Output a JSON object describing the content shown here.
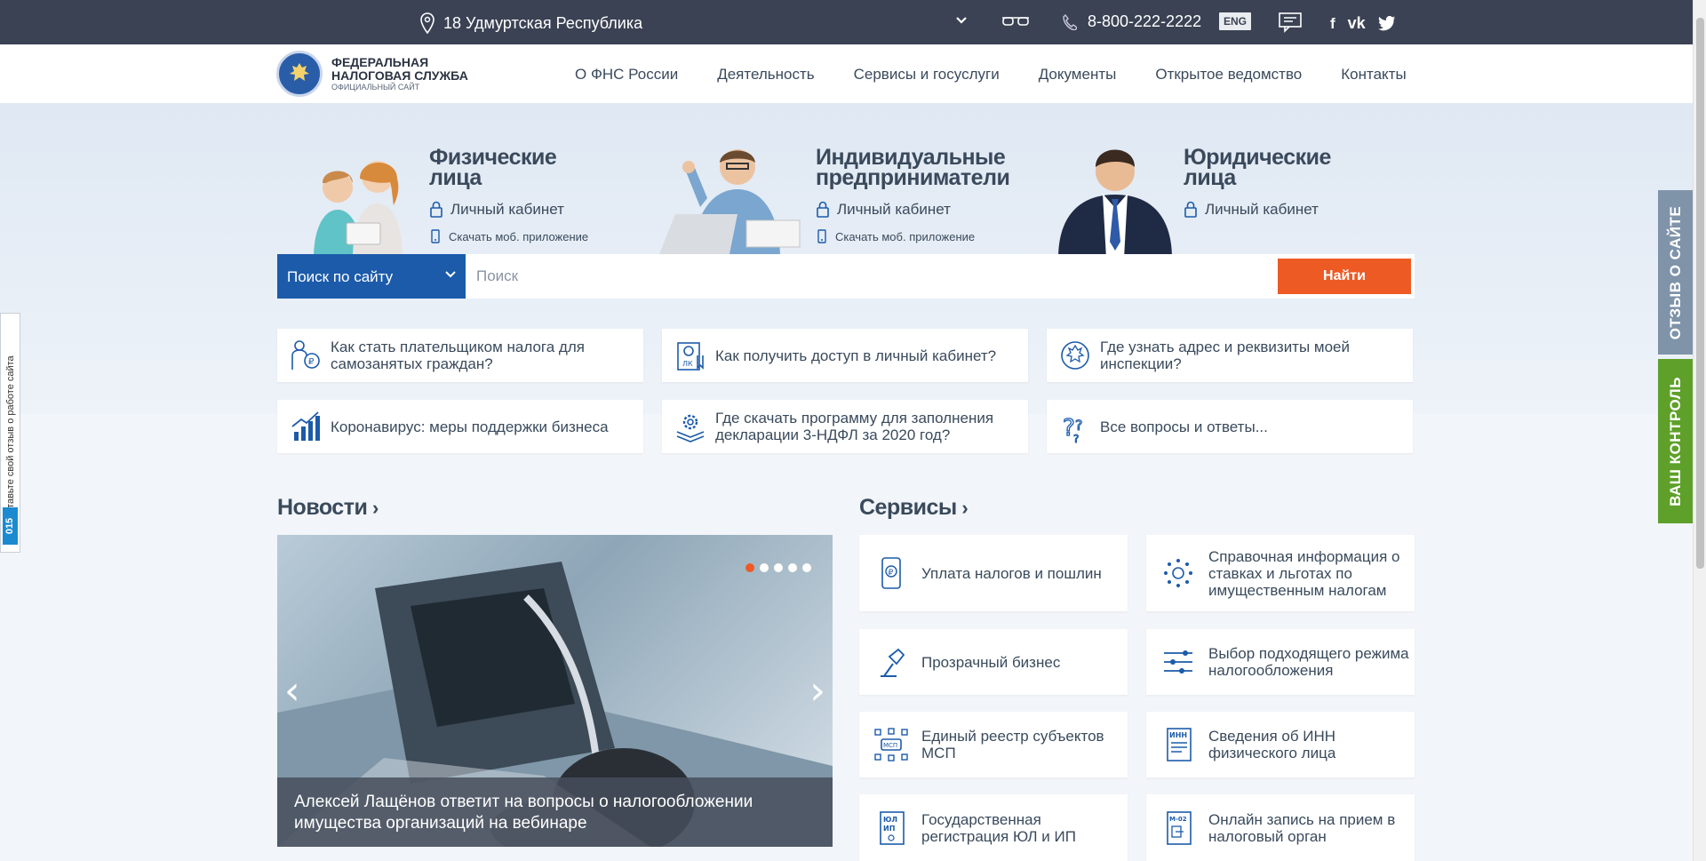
{
  "topbar": {
    "region": "18 Удмуртская Республика",
    "phone": "8-800-222-2222",
    "lang": "ENG",
    "social": [
      "f",
      "vk",
      "twitter"
    ]
  },
  "header": {
    "logo_line1": "ФЕДЕРАЛЬНАЯ",
    "logo_line2": "НАЛОГОВАЯ СЛУЖБА",
    "logo_line3": "ОФИЦИАЛЬНЫЙ САЙТ",
    "nav": [
      "О ФНС России",
      "Деятельность",
      "Сервисы и госуслуги",
      "Документы",
      "Открытое ведомство",
      "Контакты"
    ]
  },
  "hero": {
    "groups": [
      {
        "title1": "Физические",
        "title2": "лица",
        "cabinet": "Личный кабинет",
        "app": "Скачать моб. приложение"
      },
      {
        "title1": "Индивидуальные",
        "title2": "предприниматели",
        "cabinet": "Личный кабинет",
        "app": "Скачать моб. приложение"
      },
      {
        "title1": "Юридические",
        "title2": "лица",
        "cabinet": "Личный кабинет"
      }
    ]
  },
  "search": {
    "scope": "Поиск по сайту",
    "placeholder": "Поиск",
    "button": "Найти"
  },
  "quick": [
    {
      "text": "Как стать плательщиком налога для самозанятых граждан?",
      "icon": "selfemployed-icon"
    },
    {
      "text": "Как получить доступ в личный кабинет?",
      "icon": "cabinet-key-icon"
    },
    {
      "text": "Где узнать адрес и реквизиты моей инспекции?",
      "icon": "emblem-icon"
    },
    {
      "text": "Коронавирус: меры поддержки бизнеса",
      "icon": "growth-chart-icon"
    },
    {
      "text": "Где скачать программу для заполнения декларации 3-НДФЛ за 2020 год?",
      "icon": "software-gear-icon"
    },
    {
      "text": "Все вопросы и ответы...",
      "icon": "questions-icon"
    }
  ],
  "news": {
    "title": "Новости",
    "caption": "Алексей Лащёнов ответит на вопросы о налогообложении имущества организаций на вебинаре",
    "slide_count": 5,
    "active_slide": 1
  },
  "services": {
    "title": "Сервисы",
    "items": [
      {
        "text": "Уплата налогов и пошлин",
        "icon": "payment-phone-icon"
      },
      {
        "text": "Справочная информация о ставках и льготах по имущественным налогам",
        "icon": "property-info-icon"
      },
      {
        "text": "Прозрачный бизнес",
        "icon": "lamp-icon"
      },
      {
        "text": "Выбор подходящего режима налогообложения",
        "icon": "sliders-icon"
      },
      {
        "text": "Единый реестр субъектов МСП",
        "icon": "msp-registry-icon"
      },
      {
        "text": "Сведения об ИНН физического лица",
        "icon": "inn-document-icon"
      },
      {
        "text": "Государственная регистрация ЮЛ и ИП",
        "icon": "registration-icon"
      },
      {
        "text": "Онлайн запись на прием в налоговый орган",
        "icon": "appointment-icon"
      }
    ]
  },
  "side": {
    "feedback": "ОТЗЫВ О САЙТЕ",
    "control": "ВАШ КОНТРОЛЬ",
    "left_text": "Оставьте свой отзыв о работе сайта",
    "left_count": "015"
  },
  "colors": {
    "topbar": "#3b4254",
    "accent_blue": "#1c5baa",
    "accent_orange": "#ee5a24",
    "feedback_tab": "#7f93a9",
    "control_tab": "#5ea02a"
  }
}
